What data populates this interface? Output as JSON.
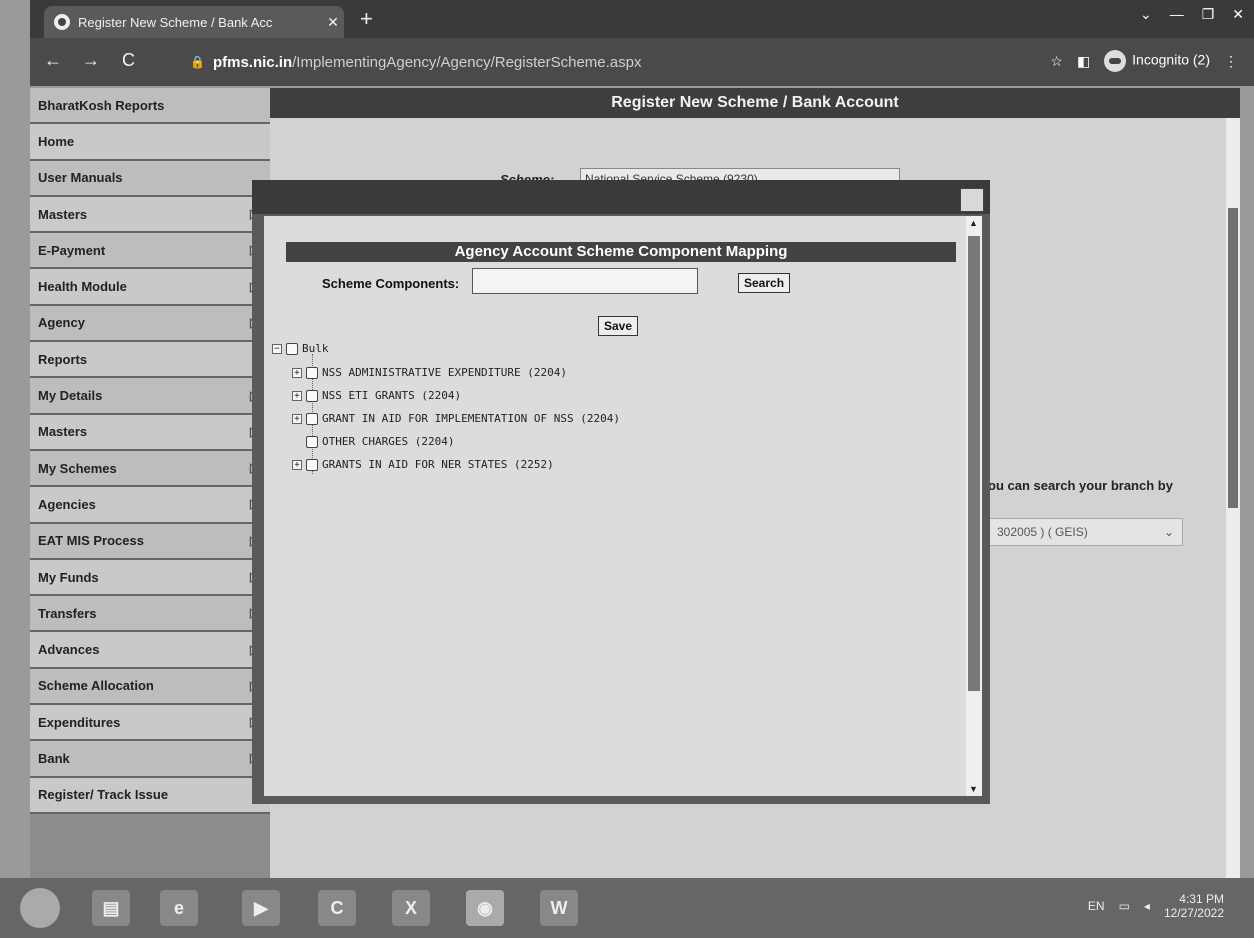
{
  "browser": {
    "tab_title": "Register New Scheme / Bank Acc",
    "tab_close": "✕",
    "new_tab": "+",
    "url_host": "pfms.nic.in",
    "url_path": "/ImplementingAgency/Agency/RegisterScheme.aspx",
    "profile_label": "Incognito (2)"
  },
  "sidebar": {
    "items": [
      {
        "label": "BharatKosh Reports",
        "has_submenu": false
      },
      {
        "label": "Home",
        "has_submenu": false
      },
      {
        "label": "User Manuals",
        "has_submenu": false
      },
      {
        "label": "Masters",
        "has_submenu": true
      },
      {
        "label": "E-Payment",
        "has_submenu": true
      },
      {
        "label": "Health Module",
        "has_submenu": true
      },
      {
        "label": "Agency",
        "has_submenu": true
      },
      {
        "label": "Reports",
        "has_submenu": false
      },
      {
        "label": "My Details",
        "has_submenu": true
      },
      {
        "label": "Masters",
        "has_submenu": true
      },
      {
        "label": "My Schemes",
        "has_submenu": true
      },
      {
        "label": "Agencies",
        "has_submenu": true
      },
      {
        "label": "EAT MIS Process",
        "has_submenu": true
      },
      {
        "label": "My Funds",
        "has_submenu": true
      },
      {
        "label": "Transfers",
        "has_submenu": true
      },
      {
        "label": "Advances",
        "has_submenu": true
      },
      {
        "label": "Scheme Allocation",
        "has_submenu": true
      },
      {
        "label": "Expenditures",
        "has_submenu": true
      },
      {
        "label": "Bank",
        "has_submenu": true
      },
      {
        "label": "Register/ Track Issue",
        "has_submenu": false
      }
    ]
  },
  "page": {
    "title": "Register New Scheme / Bank Account",
    "scheme_label": "Scheme:",
    "scheme_value": "National Service Scheme (9230)",
    "branch_hint": "ou can search your branch by",
    "branch_value": "302005 ) ( GEIS)"
  },
  "modal": {
    "header": "Agency Account Scheme Component Mapping",
    "scheme_components_label": "Scheme Components:",
    "scheme_components_value": "",
    "search_label": "Search",
    "save_label": "Save",
    "tree": {
      "root": "Bulk",
      "children": [
        {
          "label": "NSS ADMINISTRATIVE EXPENDITURE (2204)",
          "expandable": true
        },
        {
          "label": "NSS ETI GRANTS (2204)",
          "expandable": true
        },
        {
          "label": "GRANT IN AID FOR IMPLEMENTATION OF NSS (2204)",
          "expandable": true
        },
        {
          "label": "OTHER CHARGES (2204)",
          "expandable": false
        },
        {
          "label": "GRANTS IN AID FOR NER STATES (2252)",
          "expandable": true
        }
      ]
    }
  },
  "taskbar": {
    "language": "EN",
    "time": "4:31 PM",
    "date": "12/27/2022"
  },
  "icons": [
    "chrome-favicon",
    "back-icon",
    "forward-icon",
    "reload-icon",
    "lock-icon",
    "star-icon",
    "sidebar-icon",
    "incognito-icon",
    "menu-icon",
    "start-icon",
    "file-explorer-icon",
    "ie-icon",
    "media-player-icon",
    "ccleaner-icon",
    "excel-icon",
    "chrome-icon",
    "word-icon"
  ]
}
